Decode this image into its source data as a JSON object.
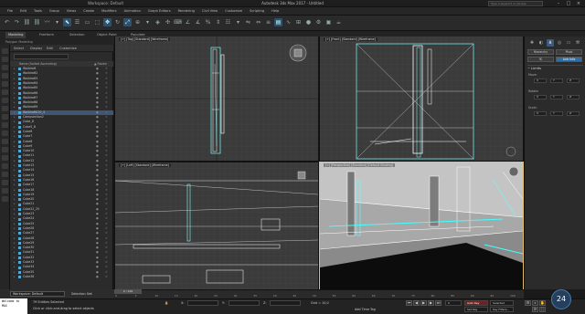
{
  "titlebar": {
    "title": "Autodesk 3ds Max 2017 · Untitled",
    "workspace": "Workspace: Default",
    "search_placeholder": "Type a keyword or phrase"
  },
  "menu": [
    "File",
    "Edit",
    "Tools",
    "Group",
    "Views",
    "Create",
    "Modifiers",
    "Animation",
    "Graph Editors",
    "Rendering",
    "Civil View",
    "Customize",
    "Scripting",
    "Help"
  ],
  "ribbon": {
    "tabs": [
      "Modeling",
      "Freeform",
      "Selection",
      "Object Paint",
      "Populate"
    ],
    "active_tab": "Modeling",
    "sub_label": "Polygon Modeling"
  },
  "explorer": {
    "tabs": [
      "Select",
      "Display",
      "Edit",
      "Customize"
    ],
    "column_name": "Name (Sorted Ascending)",
    "column_frozen": "▲ Frozen",
    "rows": [
      "Walldraft",
      "Walldraft2",
      "Walldraft3",
      "Walldraft4",
      "Walldraft5",
      "Walldraft6",
      "Walldraft7",
      "Walldraft8",
      "Walldraft9",
      "Walldraft010_4",
      "Campsection2",
      "Cube_8",
      "Cube5_8",
      "Cube6",
      "Cube7",
      "Cube8",
      "Cube9",
      "Cube10",
      "Cube11",
      "Cube12",
      "Cube13",
      "Cube14",
      "Cube15",
      "Cube16",
      "Cube17",
      "Cube18",
      "Cube19",
      "Cube20",
      "Cube21",
      "Cube22_25",
      "Cube23",
      "Cube24",
      "Cube25",
      "Cube26",
      "Cube27",
      "Cube28",
      "Cube29",
      "Cube30",
      "Cube31",
      "Cube32",
      "Cube33",
      "Cube34",
      "Cube35",
      "Cube36"
    ],
    "selected_index": 9
  },
  "viewports": {
    "top": "[+] [Top] [Standard] [Wireframe]",
    "front": "[+] [Front] [Standard] [Wireframe]",
    "left": "[+] [Left] [Standard] [Wireframe]",
    "perspective": "[+] [Perspective] [Standard] [Default Shading]"
  },
  "command_panel": {
    "buttons": [
      "Hierarchy",
      "Pivot",
      "IK",
      "Link Info"
    ],
    "rollout_title": "Limits",
    "groups": [
      {
        "label": "Move:",
        "x": "X",
        "y": "Y",
        "z": "Z"
      },
      {
        "label": "Rotate:",
        "x": "X",
        "y": "Y",
        "z": "Z"
      },
      {
        "label": "Scale:",
        "x": "X",
        "y": "Y",
        "z": "Z"
      }
    ]
  },
  "timeline": {
    "frame_label": "0 / 100",
    "ticks": [
      "0",
      "5",
      "10",
      "15",
      "20",
      "25",
      "30",
      "35",
      "40",
      "45",
      "50",
      "55",
      "60",
      "65",
      "70",
      "75",
      "80",
      "85",
      "90",
      "95",
      "100"
    ]
  },
  "workspace_bar": {
    "dropdown": "Workspace: Default",
    "selection_set": "Selection Set:"
  },
  "status": {
    "maxscript": "Welcome to MAX",
    "selected": "79 Entities Selected",
    "prompt": "Click or click-and-drag to select objects",
    "x_label": "X:",
    "y_label": "Y:",
    "z_label": "Z:",
    "grid": "Grid = 10,0",
    "add_time_tag": "Add Time Tag",
    "auto_key": "Auto Key",
    "selected_dropdown": "Selected",
    "set_key": "Set Key",
    "key_filters": "Key Filters...",
    "frame": "0"
  },
  "clock": "24"
}
